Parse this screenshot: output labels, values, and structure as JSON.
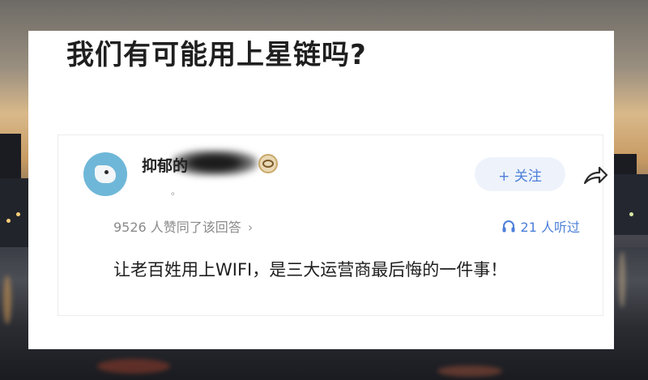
{
  "question": {
    "title": "我们有可能用上星链吗?"
  },
  "answer": {
    "author_name": "抑郁的",
    "author_sub": "。",
    "follow_label": "+ 关注",
    "upvotes_text": "9526 人赞同了该回答",
    "upvotes_chevron": "›",
    "listeners_text": "21 人听过",
    "content": "让老百姓用上WIFI，是三大运营商最后悔的一件事！"
  },
  "icons": {
    "share": "share-arrow-icon",
    "headphone": "headphone-icon",
    "badge": "eye-badge-icon",
    "follow": "plus-icon"
  },
  "colors": {
    "accent": "#4c7fd9",
    "follow_bg": "#eef3fb",
    "avatar": "#6fb7d8"
  }
}
